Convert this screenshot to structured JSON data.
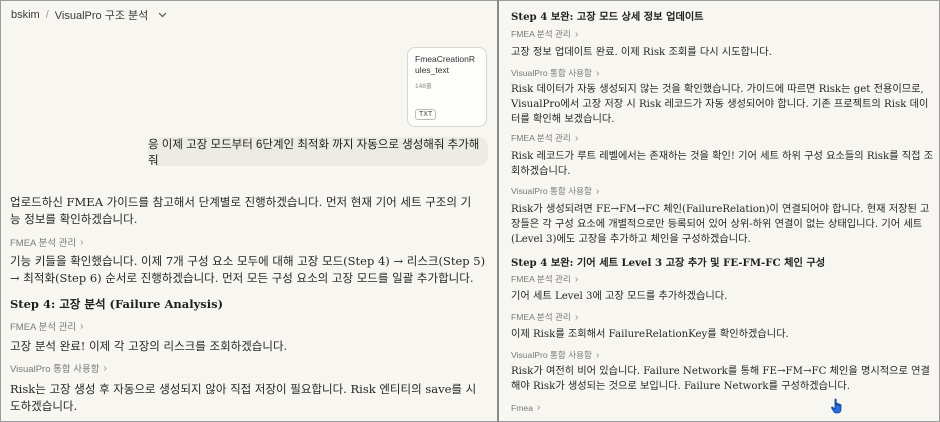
{
  "breadcrumb": {
    "user": "bskim",
    "separator": "/",
    "project": "VisualPro 구조 분석"
  },
  "attachment": {
    "filename": "FmeaCreationRules_text",
    "lines": "148줄",
    "ext": "TXT"
  },
  "user_message": "응 이제 고장 모드부터 6단계인 최적화 까지 자동으로 생성해줘 추가해 줘",
  "left": {
    "p1": "업로드하신 FMEA 가이드를 참고해서 단계별로 진행하겠습니다. 먼저 현재 기어 세트 구조의 기능 정보를 확인하겠습니다.",
    "tool1": "FMEA 분석 관리",
    "p2": "기능 키들을 확인했습니다. 이제 7개 구성 요소 모두에 대해 고장 모드(Step 4) → 리스크(Step 5) → 최적화(Step 6) 순서로 진행하겠습니다. 먼저 모든 구성 요소의 고장 모드를 일괄 추가합니다.",
    "h1": "Step 4: 고장 분석 (Failure Analysis)",
    "tool2": "FMEA 분석 관리",
    "p3": "고장 분석 완료! 이제 각 고장의 리스크를 조회하겠습니다.",
    "tool3": "VisualPro 통합 사용함",
    "p4": "Risk는 고장 생성 후 자동으로 생성되지 않아 직접 저장이 필요합니다. Risk 엔티티의 save를 시도하겠습니다."
  },
  "right": {
    "h1": "Step 4 보완: 고장 모드 상세 정보 업데이트",
    "tool1": "FMEA 분석 관리",
    "p1": "고장 정보 업데이트 완료. 이제 Risk 조회를 다시 시도합니다.",
    "tool2": "VisualPro 통합 사용함",
    "p2": "Risk 데이터가 자동 생성되지 않는 것을 확인했습니다. 가이드에 따르면 Risk는 get 전용이므로, VisualPro에서 고장 저장 시 Risk 레코드가 자동 생성되어야 합니다. 기존 프로젝트의 Risk 데이터를 확인해 보겠습니다.",
    "tool3": "FMEA 분석 관리",
    "p3": "Risk 레코드가 루트 레벨에서는 존재하는 것을 확인! 기어 세트 하위 구성 요소들의 Risk를 직접 조회하겠습니다.",
    "tool4": "VisualPro 통합 사용함",
    "p4": "Risk가 생성되려면 FE→FM→FC 체인(FailureRelation)이 연결되어야 합니다. 현재 저장된 고장들은 각 구성 요소에 개별적으로만 등록되어 있어 상위-하위 연결이 없는 상태입니다. 기어 세트(Level 3)에도 고장을 추가하고 체인을 구성하겠습니다.",
    "h2": "Step 4 보완: 기어 세트 Level 3 고장 추가 및 FE-FM-FC 체인 구성",
    "tool5": "FMEA 분석 관리",
    "p5": "기어 세트 Level 3에 고장 모드를 추가하겠습니다.",
    "tool6": "FMEA 분석 관리",
    "p6": "이제 Risk를 조회해서 FailureRelationKey를 확인하겠습니다.",
    "tool7": "VisualPro 통합 사용함",
    "p7": "Risk가 여전히 비어 있습니다. Failure Network를 통해 FE→FM→FC 체인을 명시적으로 연결해야 Risk가 생성되는 것으로 보입니다. Failure Network를 구성하겠습니다.",
    "tool8": "Fmea"
  },
  "chevron": "›"
}
